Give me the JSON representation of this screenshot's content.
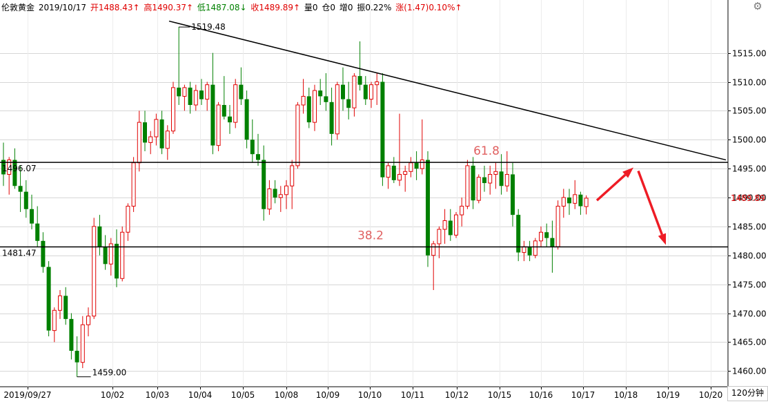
{
  "header": {
    "symbol": "伦敦黄金",
    "date": "2019/10/17",
    "open": "开1488.43↑",
    "high": "高1490.37↑",
    "low": "低1487.08↓",
    "close": "收1489.89↑",
    "volume": "量0",
    "position": "仓0",
    "increase": "增0",
    "amplitude": "振0.22%",
    "change": "涨(1.47)0.10%↑"
  },
  "period": "120分钟",
  "colors": {
    "up": "#e00000",
    "down": "#008000",
    "line": "#000000",
    "arrow": "#ee1c25",
    "fib_text": "#e06060"
  },
  "icons": {
    "settings": "gear-icon"
  },
  "chart_data": {
    "type": "candlestick",
    "ylim": [
      1458,
      1522
    ],
    "y_ticks": [
      "1460.00",
      "1465.00",
      "1470.00",
      "1475.00",
      "1480.00",
      "1485.00",
      "1490.00",
      "1495.00",
      "1500.00",
      "1505.00",
      "1510.00",
      "1515.00"
    ],
    "x_labels": [
      "2019/09/27",
      "10/02",
      "10/03",
      "10/04",
      "10/05",
      "10/08",
      "10/09",
      "10/10",
      "10/11",
      "10/12",
      "10/15",
      "10/16",
      "10/17",
      "10/18",
      "10/19",
      "10/20"
    ],
    "last_price": "1489.89",
    "high_label": "1519.48",
    "low_label": "1459.00",
    "levels": [
      {
        "value": 1496.07,
        "label": "1496.07",
        "fib": "61.8"
      },
      {
        "value": 1481.47,
        "label": "1481.47",
        "fib": "38.2"
      }
    ],
    "trendline": {
      "from": {
        "x": "10/03",
        "y": 1520.5
      },
      "to": {
        "x": "10/19",
        "y": 1496.5
      }
    },
    "arrows": [
      {
        "from": {
          "x": "10/17",
          "y": 1489.5
        },
        "to": {
          "x": "10/18",
          "y": 1495.2
        }
      },
      {
        "from": {
          "x": "10/18",
          "y": 1494.6
        },
        "to": {
          "x": "10/19",
          "y": 1481.8
        }
      }
    ],
    "candles": [
      [
        1496.5,
        1499.5,
        1492.0,
        1494.0
      ],
      [
        1494.0,
        1497.0,
        1490.5,
        1496.5
      ],
      [
        1496.5,
        1498.5,
        1491.5,
        1492.0
      ],
      [
        1492.0,
        1495.5,
        1487.5,
        1491.0
      ],
      [
        1491.0,
        1493.0,
        1486.5,
        1488.0
      ],
      [
        1488.0,
        1490.5,
        1484.5,
        1485.5
      ],
      [
        1485.5,
        1488.5,
        1481.5,
        1482.5
      ],
      [
        1482.5,
        1484.0,
        1477.0,
        1478.0
      ],
      [
        1478.0,
        1479.0,
        1466.0,
        1467.0
      ],
      [
        1467.0,
        1471.0,
        1465.0,
        1470.5
      ],
      [
        1470.5,
        1474.0,
        1469.0,
        1473.0
      ],
      [
        1473.0,
        1474.5,
        1468.0,
        1469.0
      ],
      [
        1469.0,
        1470.0,
        1462.0,
        1463.5
      ],
      [
        1463.5,
        1466.0,
        1459.0,
        1461.5
      ],
      [
        1461.5,
        1469.5,
        1460.5,
        1468.0
      ],
      [
        1468.0,
        1471.0,
        1466.0,
        1469.5
      ],
      [
        1469.5,
        1486.5,
        1469.0,
        1485.0
      ],
      [
        1485.0,
        1487.0,
        1480.0,
        1481.5
      ],
      [
        1481.5,
        1483.5,
        1477.5,
        1478.5
      ],
      [
        1478.5,
        1483.0,
        1476.5,
        1482.0
      ],
      [
        1482.0,
        1484.5,
        1474.5,
        1476.0
      ],
      [
        1476.0,
        1485.0,
        1475.5,
        1484.0
      ],
      [
        1484.0,
        1489.0,
        1482.5,
        1488.5
      ],
      [
        1488.5,
        1497.0,
        1487.5,
        1496.0
      ],
      [
        1496.0,
        1505.0,
        1494.5,
        1503.0
      ],
      [
        1503.0,
        1505.0,
        1498.0,
        1499.5
      ],
      [
        1499.5,
        1501.5,
        1497.5,
        1500.5
      ],
      [
        1500.5,
        1504.5,
        1499.0,
        1503.5
      ],
      [
        1503.5,
        1505.0,
        1497.5,
        1498.5
      ],
      [
        1498.5,
        1502.5,
        1496.5,
        1501.5
      ],
      [
        1501.5,
        1510.0,
        1501.0,
        1509.0
      ],
      [
        1509.0,
        1519.5,
        1506.0,
        1507.5
      ],
      [
        1507.5,
        1509.5,
        1505.0,
        1509.0
      ],
      [
        1509.0,
        1510.0,
        1504.5,
        1506.0
      ],
      [
        1506.0,
        1509.5,
        1505.0,
        1508.5
      ],
      [
        1508.5,
        1510.5,
        1506.0,
        1507.0
      ],
      [
        1507.0,
        1510.0,
        1505.0,
        1509.5
      ],
      [
        1509.5,
        1515.0,
        1497.5,
        1499.0
      ],
      [
        1499.0,
        1506.5,
        1498.0,
        1506.0
      ],
      [
        1506.0,
        1511.0,
        1503.5,
        1504.0
      ],
      [
        1504.0,
        1506.0,
        1501.0,
        1503.0
      ],
      [
        1503.0,
        1510.5,
        1502.0,
        1509.5
      ],
      [
        1509.5,
        1512.5,
        1506.0,
        1507.0
      ],
      [
        1507.0,
        1508.5,
        1498.5,
        1500.0
      ],
      [
        1500.0,
        1503.5,
        1496.0,
        1497.5
      ],
      [
        1497.5,
        1501.0,
        1495.5,
        1496.5
      ],
      [
        1496.5,
        1499.0,
        1486.0,
        1488.0
      ],
      [
        1488.0,
        1493.0,
        1487.0,
        1491.5
      ],
      [
        1491.5,
        1493.0,
        1489.0,
        1490.0
      ],
      [
        1490.0,
        1492.0,
        1487.5,
        1490.5
      ],
      [
        1490.5,
        1493.0,
        1488.0,
        1492.0
      ],
      [
        1492.0,
        1496.5,
        1488.0,
        1495.5
      ],
      [
        1495.5,
        1506.5,
        1495.0,
        1506.0
      ],
      [
        1506.0,
        1510.5,
        1504.5,
        1507.5
      ],
      [
        1507.5,
        1509.0,
        1502.0,
        1503.0
      ],
      [
        1503.0,
        1509.5,
        1501.5,
        1508.5
      ],
      [
        1508.5,
        1510.5,
        1506.0,
        1507.5
      ],
      [
        1507.5,
        1511.5,
        1505.0,
        1506.5
      ],
      [
        1506.5,
        1509.0,
        1499.0,
        1501.0
      ],
      [
        1501.0,
        1510.0,
        1500.0,
        1509.5
      ],
      [
        1509.5,
        1512.5,
        1505.0,
        1507.0
      ],
      [
        1507.0,
        1510.0,
        1503.5,
        1505.5
      ],
      [
        1505.5,
        1511.5,
        1504.0,
        1511.0
      ],
      [
        1511.0,
        1517.0,
        1508.5,
        1509.5
      ],
      [
        1509.5,
        1511.0,
        1506.0,
        1507.0
      ],
      [
        1507.0,
        1510.0,
        1505.5,
        1509.5
      ],
      [
        1509.5,
        1511.5,
        1506.0,
        1510.0
      ],
      [
        1510.0,
        1511.5,
        1492.0,
        1493.5
      ],
      [
        1493.5,
        1496.0,
        1491.5,
        1495.5
      ],
      [
        1495.5,
        1497.0,
        1492.5,
        1493.0
      ],
      [
        1493.0,
        1504.5,
        1492.0,
        1494.0
      ],
      [
        1494.0,
        1495.5,
        1491.0,
        1494.5
      ],
      [
        1494.5,
        1497.0,
        1493.5,
        1496.0
      ],
      [
        1496.0,
        1498.0,
        1493.0,
        1495.0
      ],
      [
        1495.0,
        1503.5,
        1494.0,
        1496.5
      ],
      [
        1496.5,
        1498.0,
        1478.0,
        1480.0
      ],
      [
        1480.0,
        1482.5,
        1474.0,
        1482.0
      ],
      [
        1482.0,
        1485.0,
        1479.5,
        1484.5
      ],
      [
        1484.5,
        1488.0,
        1482.0,
        1486.0
      ],
      [
        1486.0,
        1488.0,
        1482.5,
        1483.5
      ],
      [
        1483.5,
        1487.5,
        1483.0,
        1487.0
      ],
      [
        1487.0,
        1490.0,
        1485.0,
        1488.5
      ],
      [
        1488.5,
        1496.5,
        1488.0,
        1495.5
      ],
      [
        1495.5,
        1497.0,
        1488.0,
        1489.5
      ],
      [
        1489.5,
        1494.0,
        1489.0,
        1493.5
      ],
      [
        1493.5,
        1495.5,
        1491.0,
        1492.5
      ],
      [
        1492.5,
        1495.5,
        1490.5,
        1494.0
      ],
      [
        1494.0,
        1496.0,
        1491.5,
        1494.5
      ],
      [
        1494.5,
        1497.5,
        1490.5,
        1492.0
      ],
      [
        1492.0,
        1498.0,
        1491.0,
        1494.0
      ],
      [
        1494.0,
        1496.0,
        1485.0,
        1487.0
      ],
      [
        1487.0,
        1488.0,
        1479.0,
        1480.5
      ],
      [
        1480.5,
        1482.5,
        1479.0,
        1481.5
      ],
      [
        1481.5,
        1482.5,
        1479.0,
        1480.0
      ],
      [
        1480.0,
        1483.0,
        1479.5,
        1482.5
      ],
      [
        1482.5,
        1485.0,
        1481.5,
        1484.0
      ],
      [
        1484.0,
        1485.5,
        1481.5,
        1483.0
      ],
      [
        1483.0,
        1486.0,
        1477.0,
        1481.5
      ],
      [
        1481.5,
        1489.5,
        1481.0,
        1488.5
      ],
      [
        1488.5,
        1491.5,
        1486.5,
        1490.0
      ],
      [
        1490.0,
        1491.5,
        1487.0,
        1489.0
      ],
      [
        1489.0,
        1493.0,
        1488.0,
        1490.5
      ],
      [
        1490.5,
        1491.0,
        1487.0,
        1488.5
      ],
      [
        1488.43,
        1490.37,
        1487.08,
        1489.89
      ]
    ]
  }
}
